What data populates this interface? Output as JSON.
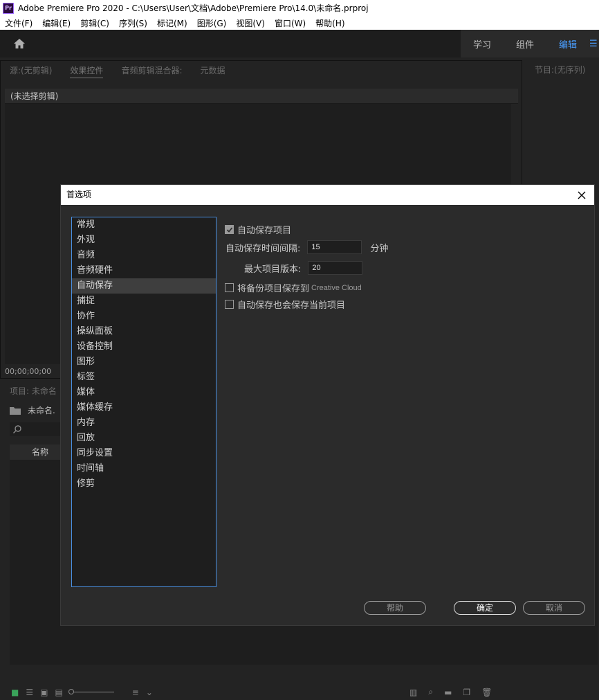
{
  "window": {
    "title": "Adobe Premiere Pro 2020 - C:\\Users\\User\\文档\\Adobe\\Premiere Pro\\14.0\\未命名.prproj",
    "app_icon": "Pr"
  },
  "menubar": [
    "文件(F)",
    "编辑(E)",
    "剪辑(C)",
    "序列(S)",
    "标记(M)",
    "图形(G)",
    "视图(V)",
    "窗口(W)",
    "帮助(H)"
  ],
  "workspace": {
    "tabs": [
      "学习",
      "组件",
      "编辑"
    ],
    "active": "编辑"
  },
  "source_panel": {
    "tabs": [
      "源:(无剪辑)",
      "效果控件",
      "音频剪辑混合器:",
      "元数据"
    ],
    "no_clip": "(未选择剪辑)",
    "timecode": "00;00;00;00"
  },
  "program_panel": {
    "label": "节目:(无序列)"
  },
  "project_panel": {
    "tab": "项目: 未命名",
    "name": "未命名.",
    "column_name": "名称"
  },
  "dialog": {
    "title": "首选项",
    "categories": [
      "常规",
      "外观",
      "音频",
      "音频硬件",
      "自动保存",
      "捕捉",
      "协作",
      "操纵面板",
      "设备控制",
      "图形",
      "标签",
      "媒体",
      "媒体缓存",
      "内存",
      "回放",
      "同步设置",
      "时间轴",
      "修剪"
    ],
    "selected_category": "自动保存",
    "autosave": {
      "enable_label": "自动保存项目",
      "enable_checked": true,
      "interval_label": "自动保存时间间隔:",
      "interval_value": "15",
      "interval_unit": "分钟",
      "max_versions_label": "最大项目版本:",
      "max_versions_value": "20",
      "backup_label": "将备份项目保存到",
      "backup_label_en": "Creative Cloud",
      "backup_checked": false,
      "save_current_label": "自动保存也会保存当前项目",
      "save_current_checked": false
    },
    "buttons": {
      "help": "帮助",
      "ok": "确定",
      "cancel": "取消"
    }
  },
  "colors": {
    "accent_blue": "#4a9eff",
    "selection": "#3e3e3e",
    "dialog_bg": "#2b2b2b"
  }
}
